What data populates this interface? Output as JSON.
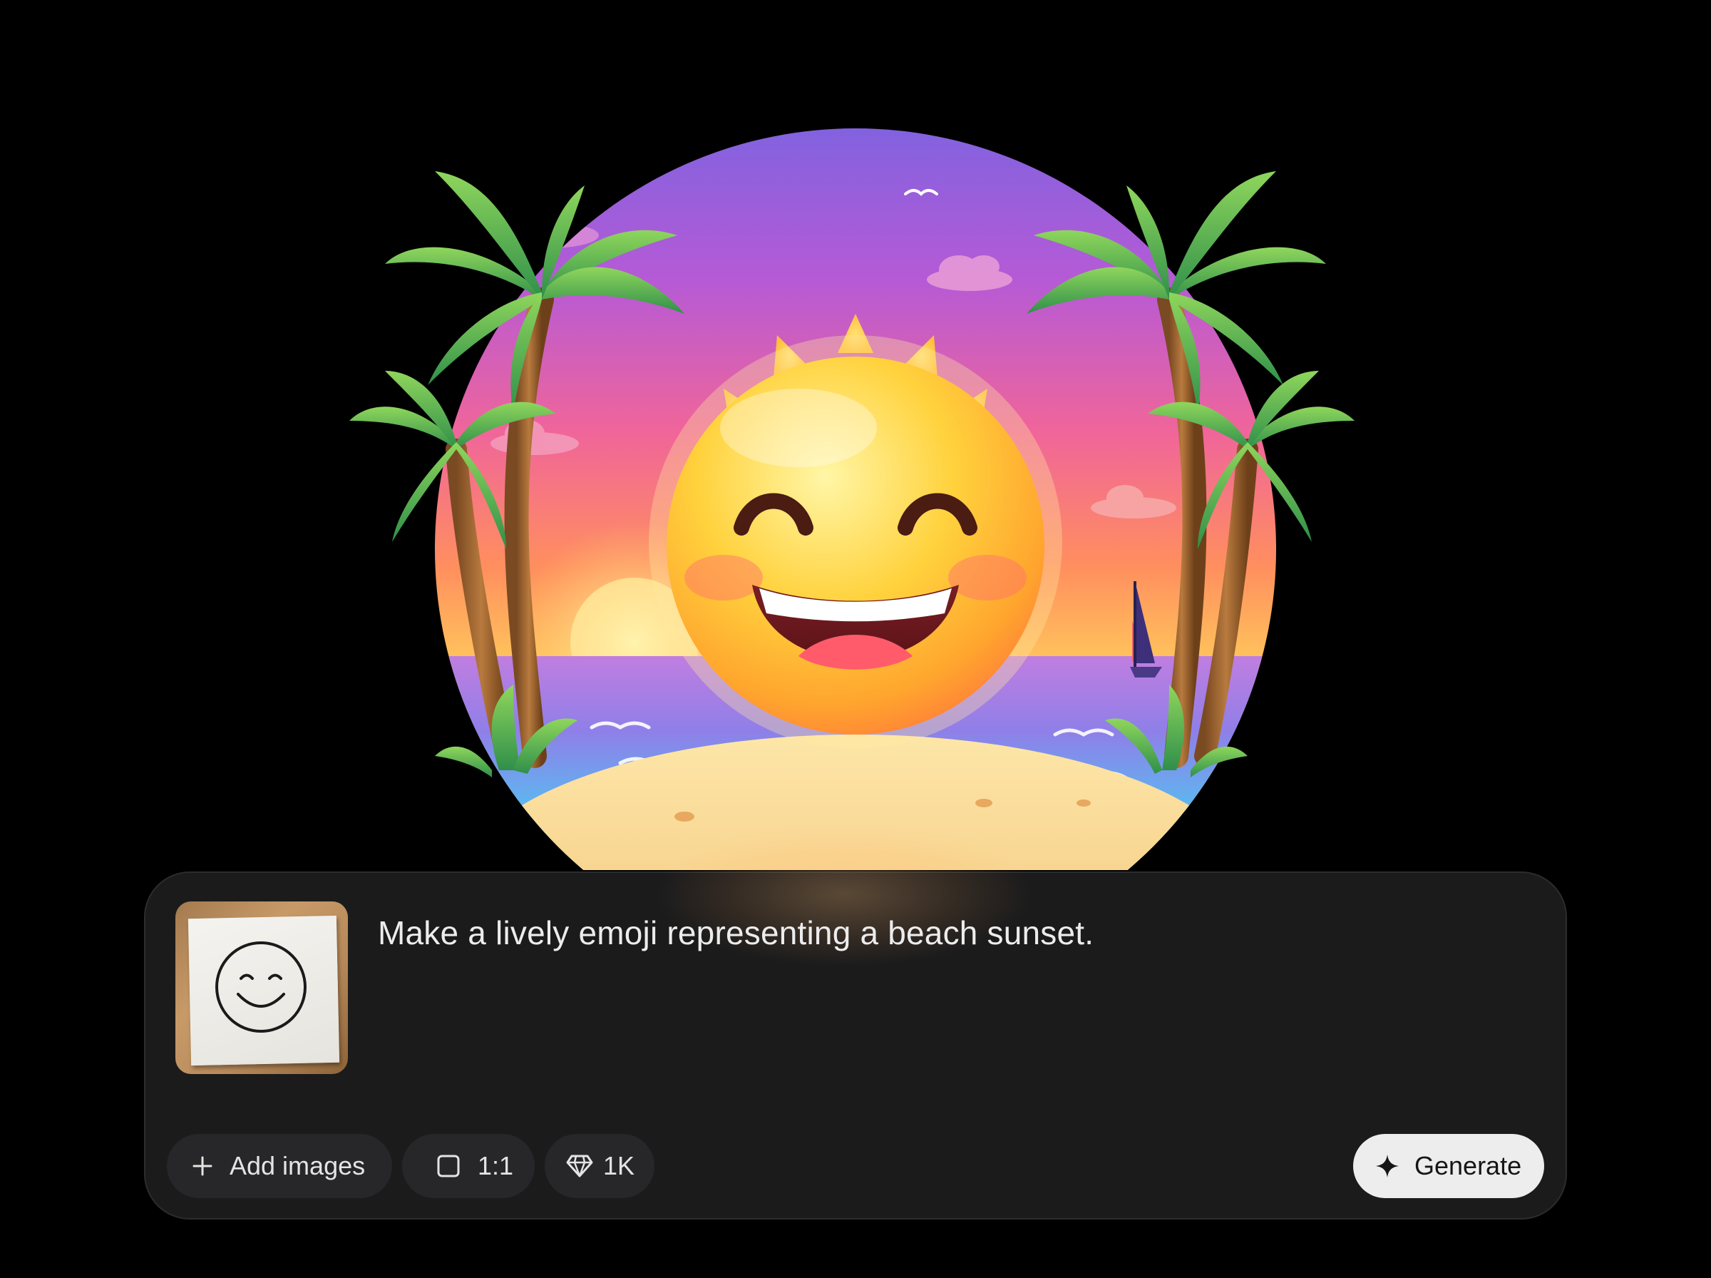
{
  "hero_image": {
    "icon": "sun-emoji-beach-sunset-image"
  },
  "composer": {
    "prompt_text": "Make a lively emoji representing a beach sunset.",
    "attachment": {
      "icon": "smiley-sketch-note-thumbnail"
    },
    "add_images": {
      "icon": "plus-icon",
      "label": "Add images"
    },
    "aspect_ratio": {
      "icon": "square-icon",
      "label": "1:1"
    },
    "resolution": {
      "icon": "diamond-icon",
      "label": "1K"
    },
    "generate": {
      "icon": "sparkle-icon",
      "label": "Generate"
    }
  },
  "colors": {
    "background": "#000000",
    "composer_bg": "#1b1b1c",
    "chip_bg": "#272729",
    "generate_bg": "#ededed",
    "text": "#ececec"
  }
}
